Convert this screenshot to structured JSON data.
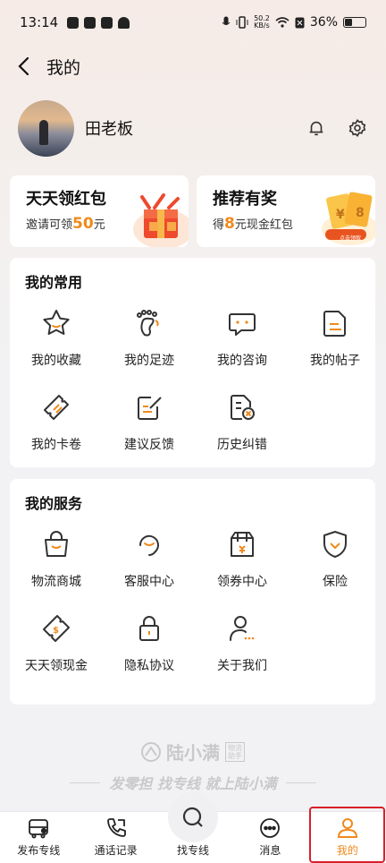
{
  "status_bar": {
    "time": "13:14",
    "net_speed_value": "50.2",
    "net_speed_unit": "KB/s",
    "battery": "36%"
  },
  "header": {
    "title": "我的"
  },
  "profile": {
    "name": "田老板"
  },
  "promos": [
    {
      "title": "天天领红包",
      "sub_prefix": "邀请可领",
      "sub_highlight": "50",
      "sub_suffix": "元"
    },
    {
      "title": "推荐有奖",
      "sub_prefix": "得",
      "sub_highlight": "8",
      "sub_suffix": "元现金红包",
      "badge": "点击领取"
    }
  ],
  "common": {
    "title": "我的常用",
    "items": [
      {
        "label": "我的收藏",
        "icon": "star-icon"
      },
      {
        "label": "我的足迹",
        "icon": "footprint-icon"
      },
      {
        "label": "我的咨询",
        "icon": "chat-bubble-icon"
      },
      {
        "label": "我的帖子",
        "icon": "document-icon"
      },
      {
        "label": "我的卡卷",
        "icon": "ticket-icon"
      },
      {
        "label": "建议反馈",
        "icon": "edit-note-icon"
      },
      {
        "label": "历史纠错",
        "icon": "file-error-icon"
      }
    ]
  },
  "service": {
    "title": "我的服务",
    "items": [
      {
        "label": "物流商城",
        "icon": "shopping-bag-icon"
      },
      {
        "label": "客服中心",
        "icon": "customer-service-icon"
      },
      {
        "label": "领券中心",
        "icon": "coupon-box-icon"
      },
      {
        "label": "保险",
        "icon": "shield-icon"
      },
      {
        "label": "天天领现金",
        "icon": "cash-icon"
      },
      {
        "label": "隐私协议",
        "icon": "lock-icon"
      },
      {
        "label": "关于我们",
        "icon": "user-info-icon"
      }
    ]
  },
  "watermark": {
    "brand": "陆小满",
    "tag1": "物流",
    "tag2": "助手",
    "slogan": "发零担 找专线 就上陆小满"
  },
  "tabbar": {
    "items": [
      {
        "label": "发布专线",
        "icon": "truck-icon"
      },
      {
        "label": "通话记录",
        "icon": "phone-icon"
      },
      {
        "label": "找专线",
        "icon": "search-icon"
      },
      {
        "label": "消息",
        "icon": "message-icon"
      },
      {
        "label": "我的",
        "icon": "person-icon"
      }
    ],
    "active": "我的"
  },
  "colors": {
    "accent": "#f08a1c",
    "icon_stroke": "#333333",
    "highlight_box": "#d8202a"
  }
}
